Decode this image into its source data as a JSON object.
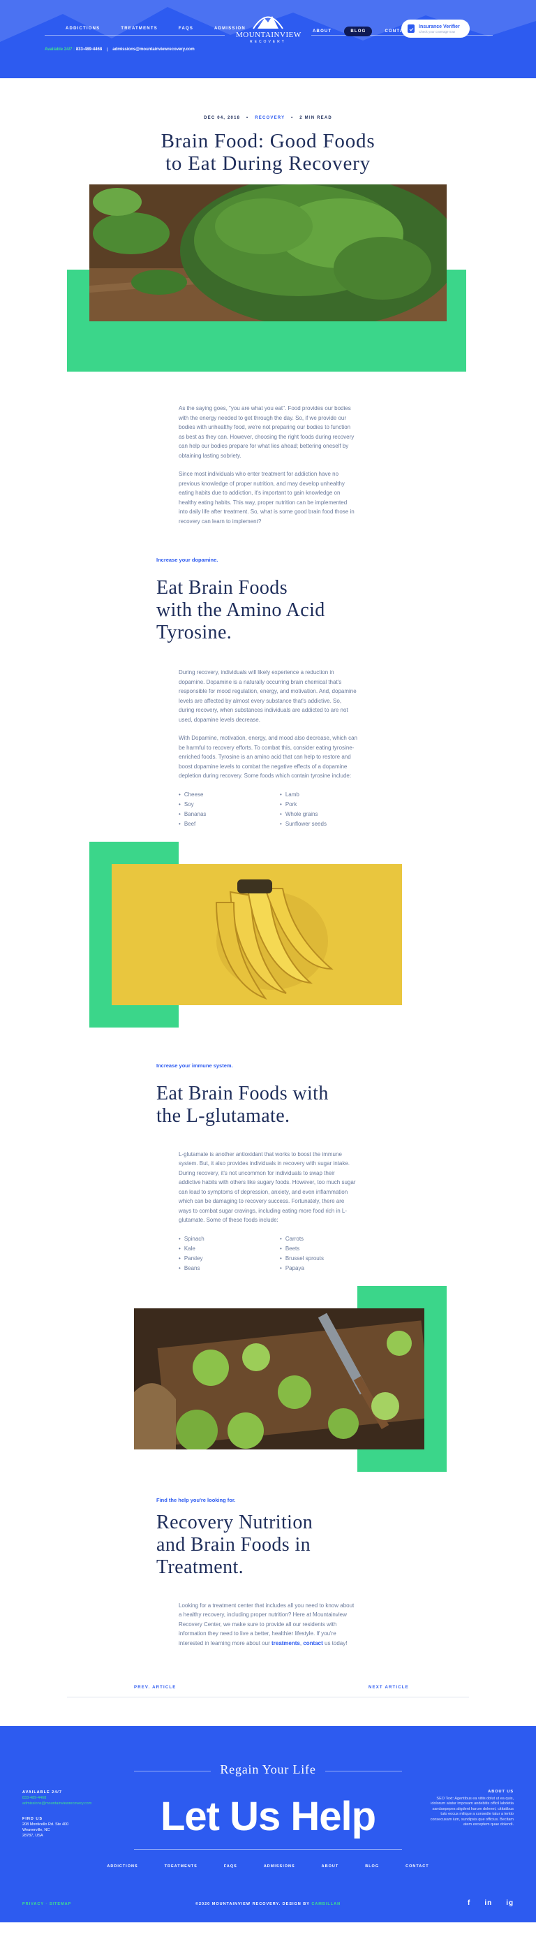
{
  "header": {
    "nav_left": [
      "ADDICTIONS",
      "TREATMENTS",
      "FAQS",
      "ADMISSION"
    ],
    "nav_right": [
      "ABOUT",
      "BLOG",
      "CONTACT"
    ],
    "active_nav": "BLOG",
    "logo_name": "MOUNTAINVIEW",
    "logo_sub": "RECOVERY",
    "verify_title": "Insurance Verifier",
    "verify_sub": "Check your coverage now",
    "available": "Available 24/7",
    "phone": "833-489-4468",
    "email": "admissions@mountainviewrecovery.com",
    "accent": "#2d5bf0",
    "green": "#3bd68a"
  },
  "article": {
    "date": "DEC 04, 2018",
    "category": "RECOVERY",
    "read_time": "2 MIN READ",
    "title_line1": "Brain Food: Good Foods",
    "title_line2": "to Eat During Recovery",
    "intro_p1": "As the saying goes, \"you are what you eat\". Food provides our bodies with the energy needed to get through the day. So, if we provide our bodies with unhealthy food, we're not preparing our bodies to function as best as they can. However, choosing the right foods during recovery can help our bodies prepare for what lies ahead; bettering oneself by obtaining lasting sobriety.",
    "intro_p2": "Since most individuals who enter treatment for addiction have no previous knowledge of proper nutrition, and may develop unhealthy eating habits due to addiction, it's important to gain knowledge on healthy eating habits. This way, proper nutrition can be implemented into daily life after treatment. So, what is some good brain food those in recovery can learn to implement?",
    "section1": {
      "eyebrow": "Increase your dopamine.",
      "heading_l1": "Eat Brain Foods",
      "heading_l2": "with the Amino Acid",
      "heading_l3": "Tyrosine.",
      "p1": "During recovery, individuals will likely experience a reduction in dopamine. Dopamine is a naturally occurring brain chemical that's responsible for mood regulation, energy, and motivation. And, dopamine levels are affected by almost every substance that's addictive. So, during recovery, when substances individuals are addicted to are not used, dopamine levels decrease.",
      "p2": "With Dopamine, motivation, energy, and mood also decrease, which can be harmful to recovery efforts. To combat this, consider eating tyrosine-enriched foods. Tyrosine is an amino acid that can help to restore and boost dopamine levels to combat the negative effects of a dopamine depletion during recovery. Some foods which contain tyrosine include:",
      "list_a": [
        "Cheese",
        "Soy",
        "Bananas",
        "Beef"
      ],
      "list_b": [
        "Lamb",
        "Pork",
        "Whole grains",
        "Sunflower seeds"
      ]
    },
    "section2": {
      "eyebrow": "Increase your immune system.",
      "heading_l1": "Eat Brain Foods with",
      "heading_l2": "the L-glutamate.",
      "p1": "L-glutamate is another antioxidant that works to boost the immune system. But, it also provides individuals in recovery with sugar intake. During recovery, it's not uncommon for individuals to swap their addictive habits with others like sugary foods. However, too much sugar can lead to symptoms of depression, anxiety, and even inflammation which can be damaging to recovery success. Fortunately, there are ways to combat sugar cravings, including eating more food rich in L-glutamate. Some of these foods include:",
      "list_a": [
        "Spinach",
        "Kale",
        "Parsley",
        "Beans"
      ],
      "list_b": [
        "Carrots",
        "Beets",
        "Brussel sprouts",
        "Papaya"
      ]
    },
    "section3": {
      "eyebrow": "Find the help you're looking for.",
      "heading_l1": "Recovery Nutrition",
      "heading_l2": "and Brain Foods in",
      "heading_l3": "Treatment.",
      "p1_before": "Looking for a treatment center that includes all you need to know about a healthy recovery, including proper nutrition? Here at Mountainview Recovery Center, we make sure to provide all our residents with information they need to live a better, healthier lifestyle. If you're interested in learning more about our ",
      "link1": "treatments",
      "comma": ", ",
      "link2": "contact",
      "p1_after": " us today!"
    },
    "prev": "PREV. ARTICLE",
    "next": "NEXT ARTICLE"
  },
  "footer": {
    "regain": "Regain Your Life",
    "lethelp": "Let Us Help",
    "available_label": "AVAILABLE 24/7",
    "phone": "833-489-4468",
    "email": "admissions@mountainviewrecovery.com",
    "find_label": "FIND US",
    "address1": "208 Monticello Rd. Ste 400",
    "address2": "Weaverville, NC",
    "address3": "28787, USA",
    "about_label": "ABOUT US",
    "about_text": "SEO Text: Agentibus ea vitiis dolut ut ea quis, idolorum atatur imposam andebitis officil labdetia sandaepepes aligdent harum dolenet, cititatibus tuto eocus milique a consedie tatur a tentio consecusam ium, sundipsis que officius. Becitam atem exceptem quae dolendi.",
    "nav": [
      "ADDICTIONS",
      "TREATMENTS",
      "FAQS",
      "ADMISSIONS",
      "ABOUT",
      "BLOG",
      "CONTACT"
    ],
    "legal": "PRIVACY  ·  SITEMAP",
    "copyright": "©2020 MOUNTAINVIEW RECOVERY. DESIGN BY ",
    "design_by": "CAMBILLAN",
    "social": [
      "f",
      "in",
      "ig"
    ]
  }
}
